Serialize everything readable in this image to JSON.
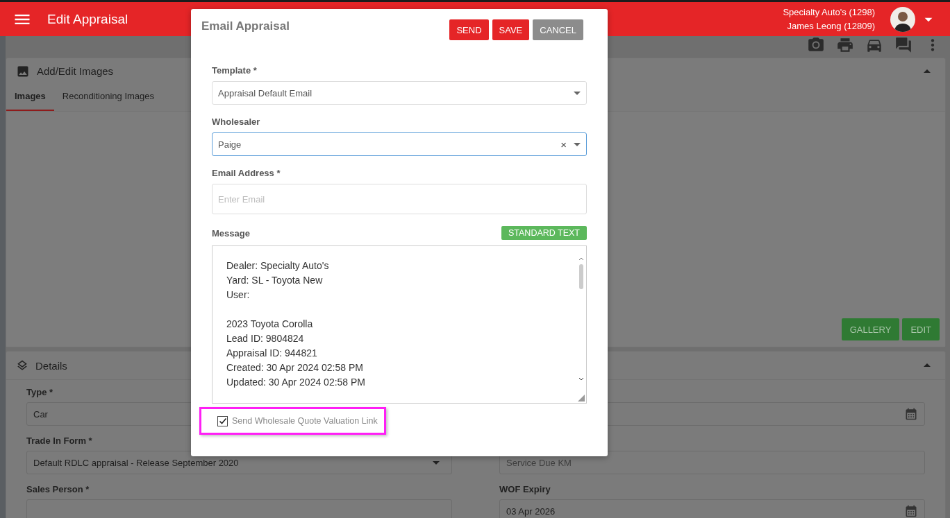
{
  "header": {
    "title": "Edit Appraisal",
    "dealer": "Specialty Auto's (1298)",
    "user": "James Leong (12809)"
  },
  "images_panel": {
    "title": "Add/Edit Images",
    "expanded": true,
    "tabs": [
      {
        "label": "Images",
        "selected": true
      },
      {
        "label": "Reconditioning Images",
        "selected": false
      }
    ],
    "buttons": [
      "GALLERY",
      "EDIT"
    ]
  },
  "details_panel": {
    "title": "Details",
    "expanded": true,
    "left_fields": [
      {
        "label": "Type *",
        "value": "Car",
        "kind": "text"
      },
      {
        "label": "Trade In Form *",
        "value": "Default RDLC appraisal - Release September 2020",
        "kind": "select"
      },
      {
        "label": "Sales Person *",
        "kind": "select"
      }
    ],
    "right_fields": [
      {
        "kind": "date"
      },
      {
        "kind": "text",
        "placeholder": "Service Due KM"
      },
      {
        "kind": "date",
        "label": "WOF Expiry",
        "value": "03 Apr 2026"
      }
    ]
  },
  "dialog": {
    "title": "Email Appraisal",
    "buttons": [
      {
        "label": "SEND",
        "kind": "primary"
      },
      {
        "label": "SAVE",
        "kind": "primary"
      },
      {
        "label": "CANCEL",
        "kind": "secondary"
      }
    ],
    "template": {
      "label": "Template *",
      "value": "Appraisal Default Email"
    },
    "wholesaler": {
      "label": "Wholesaler",
      "value": "Paige",
      "focused": true,
      "clear": "×"
    },
    "email": {
      "label": "Email Address *",
      "placeholder": "Enter Email"
    },
    "message": {
      "label": "Message",
      "standard_text_button": "STANDARD TEXT",
      "paragraphs": [
        [
          "Dealer: Specialty Auto's",
          "Yard: SL - Toyota New",
          "User:"
        ],
        [
          "2023 Toyota Corolla",
          "Lead ID: 9804824",
          "Appraisal ID: 944821",
          "Created: 30 Apr 2024 02:58 PM",
          "Updated: 30 Apr 2024 02:58 PM"
        ]
      ]
    },
    "wholesale_link": {
      "label": "Send Wholesale Quote Valuation Link",
      "checked": true,
      "highlighted": true
    }
  }
}
